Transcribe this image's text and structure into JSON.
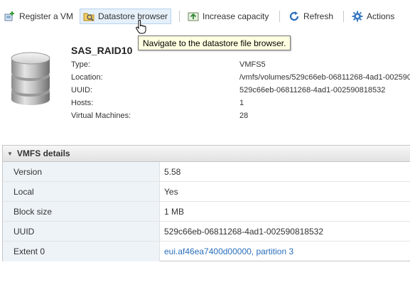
{
  "toolbar": {
    "register_vm": "Register a VM",
    "datastore_browser": "Datastore browser",
    "increase_capacity": "Increase capacity",
    "refresh": "Refresh",
    "actions": "Actions"
  },
  "tooltip": "Navigate to the datastore file browser.",
  "datastore": {
    "name": "SAS_RAID10",
    "info": [
      {
        "label": "Type:",
        "value": "VMFS5"
      },
      {
        "label": "Location:",
        "value": "/vmfs/volumes/529c66eb-06811268-4ad1-002590"
      },
      {
        "label": "UUID:",
        "value": "529c66eb-06811268-4ad1-002590818532"
      },
      {
        "label": "Hosts:",
        "value": "1"
      },
      {
        "label": "Virtual Machines:",
        "value": "28"
      }
    ]
  },
  "vmfs": {
    "title": "VMFS details",
    "rows": [
      {
        "label": "Version",
        "value": "5.58"
      },
      {
        "label": "Local",
        "value": "Yes"
      },
      {
        "label": "Block size",
        "value": "1 MB"
      },
      {
        "label": "UUID",
        "value": "529c66eb-06811268-4ad1-002590818532"
      },
      {
        "label": "Extent 0",
        "value": "eui.af46ea7400d00000, partition 3"
      }
    ]
  },
  "colors": {
    "link": "#2a6ebb",
    "tooltip_bg": "#ffffe1",
    "key_bg": "#eef3f8"
  }
}
